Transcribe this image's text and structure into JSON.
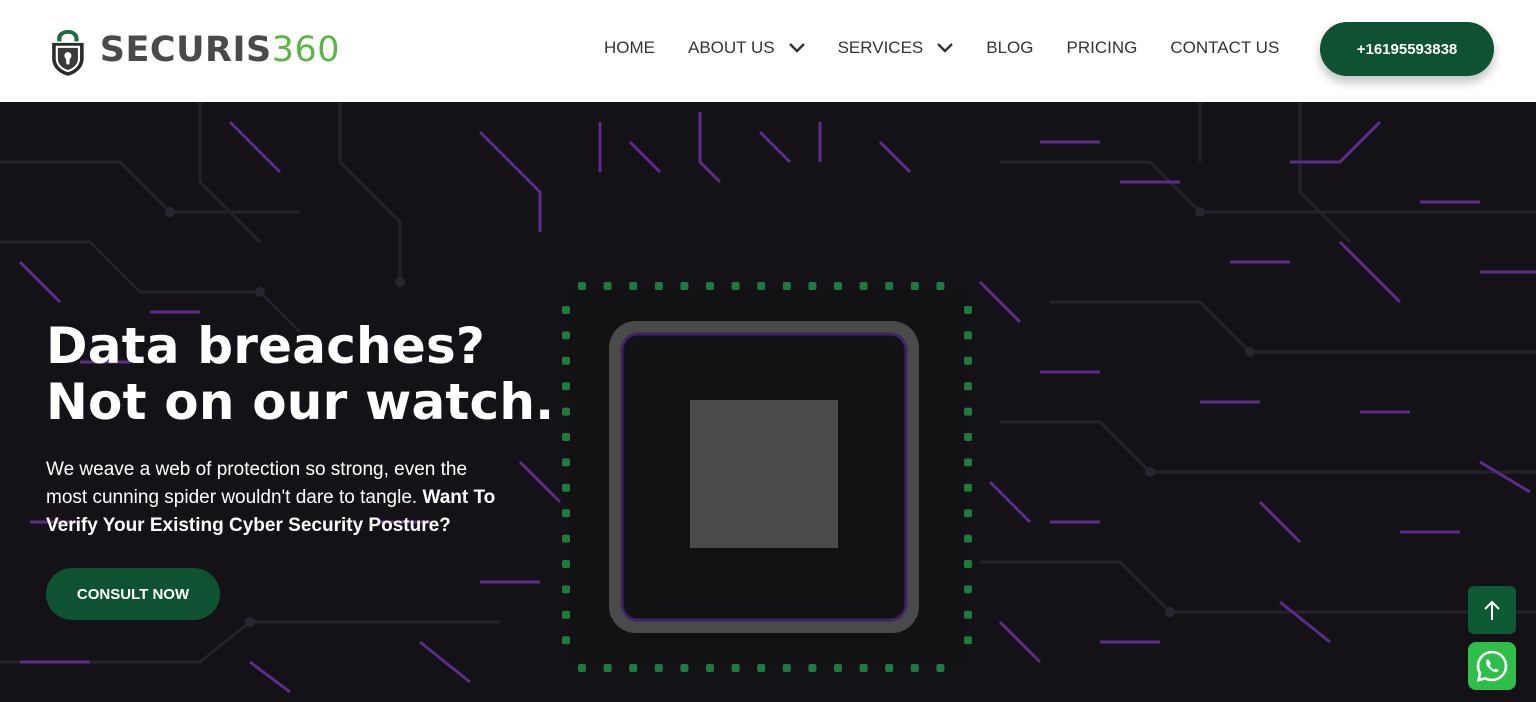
{
  "brand": {
    "name_part1": "SECURIS",
    "name_part2": "360",
    "logo_icon": "shield-lock-icon"
  },
  "nav": {
    "items": [
      {
        "label": "HOME",
        "dropdown": false
      },
      {
        "label": "ABOUT US",
        "dropdown": true
      },
      {
        "label": "SERVICES",
        "dropdown": true
      },
      {
        "label": "BLOG",
        "dropdown": false
      },
      {
        "label": "PRICING",
        "dropdown": false
      },
      {
        "label": "CONTACT US",
        "dropdown": false
      }
    ],
    "phone_button": "+16195593838"
  },
  "hero": {
    "headline_line1": "Data breaches?",
    "headline_line2": "Not on our watch.",
    "subtext": "We weave a web of protection so strong, even the most cunning spider wouldn't dare to tangle.",
    "subtext_bold": "Want To Verify Your Existing Cyber Security Posture?",
    "cta": "CONSULT NOW"
  },
  "floating": {
    "scroll_top_icon": "arrow-up-icon",
    "chat_icon": "whatsapp-icon"
  },
  "colors": {
    "brand_green": "#0e5233",
    "logo_green": "#5cb547",
    "hero_bg": "#141216",
    "circuit_purple": "#5b2c8a",
    "chip_dots": "#1f7a3e"
  }
}
